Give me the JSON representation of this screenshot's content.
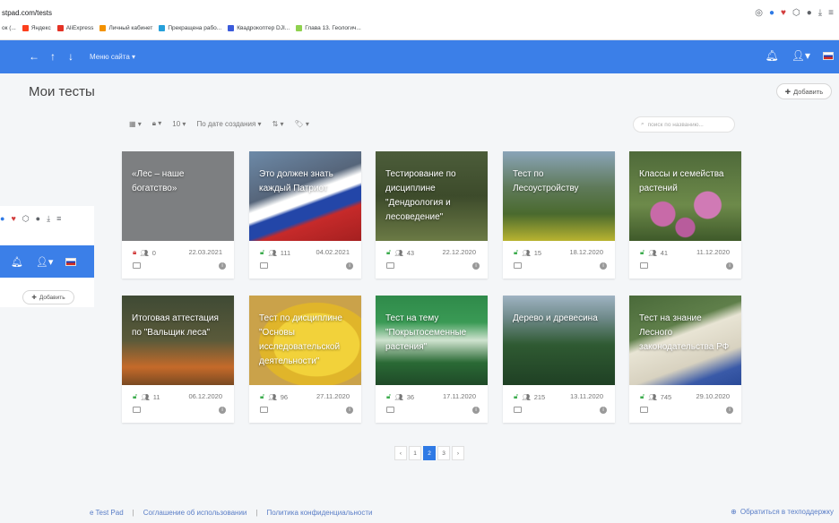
{
  "browser": {
    "url": "stpad.com/tests",
    "bookmarks": [
      "ок (...",
      "Яндекс",
      "AliExpress",
      "Личный кабинет",
      "Прекращена рабо...",
      "Квадрокоптер DJI...",
      "Глава 13. Геологич..."
    ]
  },
  "header": {
    "menu_label": "Меню сайта ▾"
  },
  "page": {
    "title": "Мои тесты",
    "add_label": "Добавить"
  },
  "toolbar": {
    "per_page": "10 ▾",
    "sort_label": "По дате создания ▾",
    "search_placeholder": "поиск по названию..."
  },
  "cards": [
    {
      "title": "«Лес – наше богатство»",
      "count": "0",
      "date": "22.03.2021",
      "lock_color": "#d23c3c"
    },
    {
      "title": "Это должен знать каждый Патриот",
      "count": "111",
      "date": "04.02.2021",
      "lock_color": "#3bab4c"
    },
    {
      "title": "Тестирование по дисциплине \"Дендрология и лесоведение\"",
      "count": "43",
      "date": "22.12.2020",
      "lock_color": "#3bab4c"
    },
    {
      "title": "Тест по Лесоустройству",
      "count": "15",
      "date": "18.12.2020",
      "lock_color": "#3bab4c"
    },
    {
      "title": "Классы и семейства растений",
      "count": "41",
      "date": "11.12.2020",
      "lock_color": "#3bab4c"
    },
    {
      "title": "Итоговая аттестация по \"Вальщик леса\"",
      "count": "11",
      "date": "06.12.2020",
      "lock_color": "#3bab4c"
    },
    {
      "title": "Тест по дисциплине \"Основы исследовательской деятельности\"",
      "count": "96",
      "date": "27.11.2020",
      "lock_color": "#3bab4c"
    },
    {
      "title": "Тест на тему \"Покрытосеменные растения\"",
      "count": "36",
      "date": "17.11.2020",
      "lock_color": "#3bab4c"
    },
    {
      "title": "Дерево и древесина",
      "count": "215",
      "date": "13.11.2020",
      "lock_color": "#3bab4c"
    },
    {
      "title": "Тест на знание Лесного законодательства РФ",
      "count": "745",
      "date": "29.10.2020",
      "lock_color": "#3bab4c"
    }
  ],
  "pagination": {
    "prev": "‹",
    "pages": [
      "1",
      "2",
      "3"
    ],
    "current": "2",
    "next": "›"
  },
  "footer": {
    "brand": "e Test Pad",
    "terms": "Соглашение об использовании",
    "privacy": "Политика конфиденциальности",
    "support": "Обратиться в техподдержку"
  },
  "colors": {
    "accent": "#3b7fe8",
    "page_active": "#2f7ae5"
  }
}
